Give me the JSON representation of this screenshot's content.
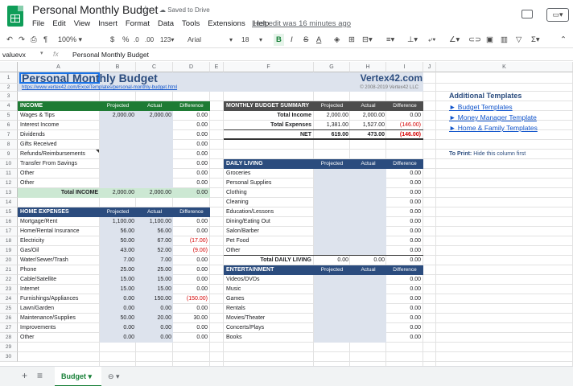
{
  "app": {
    "doc_title": "Personal Monthly Budget",
    "saved_status": "Saved to Drive",
    "last_edit": "Last edit was 16 minutes ago",
    "menus": [
      "File",
      "Edit",
      "View",
      "Insert",
      "Format",
      "Data",
      "Tools",
      "Extensions",
      "Help"
    ]
  },
  "toolbar": {
    "zoom": "100%",
    "currency": "$",
    "percent": "%",
    ".0": ".0",
    ".00": ".00",
    "format_num": "123",
    "font": "Arial",
    "font_size": "18",
    "bold": "B",
    "italic": "I",
    "strike": "S",
    "text_color": "A"
  },
  "formula_bar": {
    "name_box": "valuevx",
    "fx": "fx",
    "content": "Personal Monthly Budget"
  },
  "columns": [
    "A",
    "B",
    "C",
    "D",
    "E",
    "F",
    "G",
    "H",
    "I",
    "J",
    "K"
  ],
  "rows": [
    "1",
    "2",
    "3",
    "4",
    "5",
    "6",
    "7",
    "8",
    "9",
    "10",
    "11",
    "12",
    "13",
    "14",
    "15",
    "16",
    "17",
    "18",
    "19",
    "20",
    "21",
    "22",
    "23",
    "24",
    "25",
    "26",
    "27",
    "28",
    "29",
    "30"
  ],
  "sheet": {
    "title": "Personal Monthly Budget",
    "brand": "Vertex42.com",
    "url": "https://www.vertex42.com/ExcelTemplates/personal-monthly-budget.html",
    "copyright": "© 2008-2019 Vertex42 LLC",
    "income": {
      "header": "INCOME",
      "col_projected": "Projected",
      "col_actual": "Actual",
      "col_diff": "Difference",
      "items": [
        {
          "label": "Wages & Tips",
          "projected": "2,000.00",
          "actual": "2,000.00",
          "diff": "0.00"
        },
        {
          "label": "Interest Income",
          "projected": "",
          "actual": "",
          "diff": "0.00"
        },
        {
          "label": "Dividends",
          "projected": "",
          "actual": "",
          "diff": "0.00"
        },
        {
          "label": "Gifts Received",
          "projected": "",
          "actual": "",
          "diff": "0.00"
        },
        {
          "label": "Refunds/Reimbursements",
          "projected": "",
          "actual": "",
          "diff": "0.00"
        },
        {
          "label": "Transfer From Savings",
          "projected": "",
          "actual": "",
          "diff": "0.00"
        },
        {
          "label": "Other",
          "projected": "",
          "actual": "",
          "diff": "0.00"
        },
        {
          "label": "Other",
          "projected": "",
          "actual": "",
          "diff": "0.00"
        }
      ],
      "total_label": "Total INCOME",
      "total_projected": "2,000.00",
      "total_actual": "2,000.00",
      "total_diff": "0.00"
    },
    "home": {
      "header": "HOME EXPENSES",
      "col_projected": "Projected",
      "col_actual": "Actual",
      "col_diff": "Difference",
      "items": [
        {
          "label": "Mortgage/Rent",
          "projected": "1,100.00",
          "actual": "1,100.00",
          "diff": "0.00",
          "neg": false
        },
        {
          "label": "Home/Rental Insurance",
          "projected": "56.00",
          "actual": "56.00",
          "diff": "0.00",
          "neg": false
        },
        {
          "label": "Electricity",
          "projected": "50.00",
          "actual": "67.00",
          "diff": "(17.00)",
          "neg": true
        },
        {
          "label": "Gas/Oil",
          "projected": "43.00",
          "actual": "52.00",
          "diff": "(9.00)",
          "neg": true
        },
        {
          "label": "Water/Sewer/Trash",
          "projected": "7.00",
          "actual": "7.00",
          "diff": "0.00",
          "neg": false
        },
        {
          "label": "Phone",
          "projected": "25.00",
          "actual": "25.00",
          "diff": "0.00",
          "neg": false
        },
        {
          "label": "Cable/Satellite",
          "projected": "15.00",
          "actual": "15.00",
          "diff": "0.00",
          "neg": false
        },
        {
          "label": "Internet",
          "projected": "15.00",
          "actual": "15.00",
          "diff": "0.00",
          "neg": false
        },
        {
          "label": "Furnishings/Appliances",
          "projected": "0.00",
          "actual": "150.00",
          "diff": "(150.00)",
          "neg": true
        },
        {
          "label": "Lawn/Garden",
          "projected": "0.00",
          "actual": "0.00",
          "diff": "0.00",
          "neg": false
        },
        {
          "label": "Maintenance/Supplies",
          "projected": "50.00",
          "actual": "20.00",
          "diff": "30.00",
          "neg": false
        },
        {
          "label": "Improvements",
          "projected": "0.00",
          "actual": "0.00",
          "diff": "0.00",
          "neg": false
        },
        {
          "label": "Other",
          "projected": "0.00",
          "actual": "0.00",
          "diff": "0.00",
          "neg": false
        }
      ]
    },
    "summary": {
      "header": "MONTHLY BUDGET SUMMARY",
      "col_projected": "Projected",
      "col_actual": "Actual",
      "col_diff": "Difference",
      "rows": [
        {
          "label": "Total Income",
          "projected": "2,000.00",
          "actual": "2,000.00",
          "diff": "0.00",
          "neg": false
        },
        {
          "label": "Total Expenses",
          "projected": "1,381.00",
          "actual": "1,527.00",
          "diff": "(146.00)",
          "neg": true
        },
        {
          "label": "NET",
          "projected": "619.00",
          "actual": "473.00",
          "diff": "(146.00)",
          "neg": true
        }
      ]
    },
    "daily": {
      "header": "DAILY LIVING",
      "col_projected": "Projected",
      "col_actual": "Actual",
      "col_diff": "Difference",
      "items": [
        {
          "label": "Groceries",
          "diff": "0.00"
        },
        {
          "label": "Personal Supplies",
          "diff": "0.00"
        },
        {
          "label": "Clothing",
          "diff": "0.00"
        },
        {
          "label": "Cleaning",
          "diff": "0.00"
        },
        {
          "label": "Education/Lessons",
          "diff": "0.00"
        },
        {
          "label": "Dining/Eating Out",
          "diff": "0.00"
        },
        {
          "label": "Salon/Barber",
          "diff": "0.00"
        },
        {
          "label": "Pet Food",
          "diff": "0.00"
        },
        {
          "label": "Other",
          "diff": "0.00"
        }
      ],
      "total_label": "Total DAILY LIVING",
      "total_projected": "0.00",
      "total_actual": "0.00",
      "total_diff": "0.00"
    },
    "entertainment": {
      "header": "ENTERTAINMENT",
      "col_projected": "Projected",
      "col_actual": "Actual",
      "col_diff": "Difference",
      "items": [
        {
          "label": "Videos/DVDs",
          "diff": "0.00"
        },
        {
          "label": "Music",
          "diff": "0.00"
        },
        {
          "label": "Games",
          "diff": "0.00"
        },
        {
          "label": "Rentals",
          "diff": "0.00"
        },
        {
          "label": "Movies/Theater",
          "diff": "0.00"
        },
        {
          "label": "Concerts/Plays",
          "diff": "0.00"
        },
        {
          "label": "Books",
          "diff": "0.00"
        }
      ]
    },
    "side": {
      "title": "Additional Templates",
      "links": [
        "► Budget Templates",
        "► Money Manager Template",
        "► Home & Family Templates"
      ],
      "print_label": "To Print:",
      "print_text": "Hide this column first"
    }
  },
  "tabs": {
    "add": "+",
    "menu": "≡",
    "active": "Budget",
    "active_arrow": "▾",
    "other": "⊖ ▾"
  },
  "colors": {
    "green": "#1e7b34",
    "blue": "#2b4c7e",
    "gray": "#4d4d4d",
    "input": "#dde3ed",
    "total": "#cce8d3"
  }
}
